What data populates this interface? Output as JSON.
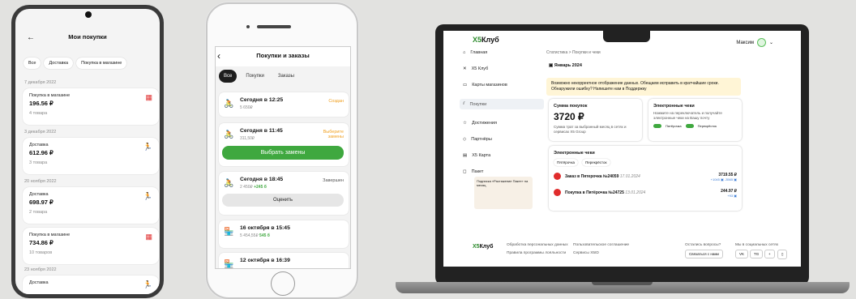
{
  "android": {
    "title": "Мои покупки",
    "back": "←",
    "chips": [
      "Все",
      "Доставка",
      "Покупка в магазине"
    ],
    "dates": [
      "7 декабря 2022",
      "3 декабря 2022",
      "20 ноября 2022",
      "23 ноября 2022"
    ],
    "cards": [
      {
        "type": "Покупка в магазине",
        "price": "196.56 ₽",
        "count": "4 товара",
        "icon": "store-icon"
      },
      {
        "type": "Доставка",
        "price": "612.96 ₽",
        "count": "3 товара",
        "icon": "courier-icon"
      },
      {
        "type": "Доставка",
        "price": "698.97 ₽",
        "count": "2 товара",
        "icon": "courier-icon"
      },
      {
        "type": "Покупка в магазине",
        "price": "734.86 ₽",
        "count": "10 товаров",
        "icon": "store-icon"
      },
      {
        "type": "Доставка",
        "price": "",
        "count": "",
        "icon": "courier-icon"
      }
    ]
  },
  "iphone": {
    "title": "Покупки и заказы",
    "back": "‹",
    "tabs": [
      "Все",
      "Покупки",
      "Заказы"
    ],
    "orders": [
      {
        "title": "Сегодня в 12:25",
        "sub": "5 650₽",
        "status": "Создан",
        "status_color": "#f0a020"
      },
      {
        "title": "Сегодня в 11:45",
        "sub": "311,50₽",
        "status": "Выберите замены",
        "status_color": "#f0a020",
        "button": "Выбрать замены"
      },
      {
        "title": "Сегодня в 18:45",
        "sub": "2 450₽",
        "bonus": "+245 б",
        "status": "Завершен",
        "status_color": "#555",
        "button": "Оценить"
      },
      {
        "title": "16 октября в 15:45",
        "sub": "5 454,55₽",
        "bonus": "545 б"
      },
      {
        "title": "12 октября в 16:39",
        "sub": "",
        "bonus": ""
      }
    ]
  },
  "web": {
    "logo_prefix": "X5",
    "logo_suffix": "Клуб",
    "user": "Максим",
    "nav": [
      "Главная",
      "X5 Клуб",
      "Карты магазинов",
      "Покупки",
      "Достижения",
      "Партнёры",
      "X5 Карта",
      "Пакет"
    ],
    "breadcrumb": "Статистика  >  Покупки и чеки",
    "month": "Январь 2024",
    "warning": "Возможно некорректное отображение данных. Обещаем исправить в кратчайшие сроки. Обнаружили ошибку? Напишите нам в Поддержку",
    "sum": {
      "title": "Сумма покупок",
      "value": "3720 ₽",
      "desc": "Сумма трат за выбранный месяц в сетях и сервисах X5 Group"
    },
    "echeck": {
      "title": "Электронные чеки",
      "desc": "Нажмите на переключатель и получайте электронные чеки на Вашу почту",
      "t1": "Пятёрочка",
      "t2": "Перекрёсток"
    },
    "receipts_title": "Электронные чеки",
    "filters": [
      "Пятёрочка",
      "Перекрёсток"
    ],
    "receipts": [
      {
        "title": "Заказ в Пятерочка №24059",
        "date": "17.01.2024",
        "amount": "3719.55 ₽",
        "bonus": "+1045 ▣  -3565 ▣"
      },
      {
        "title": "Покупка в Пятёрочка №24725",
        "date": "13.01.2024",
        "amount": "244.97 ₽",
        "bonus": "+93 ▣"
      }
    ],
    "promo": "Подписка «Растяжение Пакет» на месяц",
    "footer_links": [
      "Обработка персональных данных",
      "Пользовательское соглашение",
      "Правила программы лояльности",
      "Сервисы X5ID"
    ],
    "footer_q": "Остались вопросы?",
    "footer_btn": "Связаться с нами",
    "footer_social": "Мы в социальных сетях",
    "social": [
      "VK",
      "TG",
      "+",
      "▯"
    ]
  }
}
